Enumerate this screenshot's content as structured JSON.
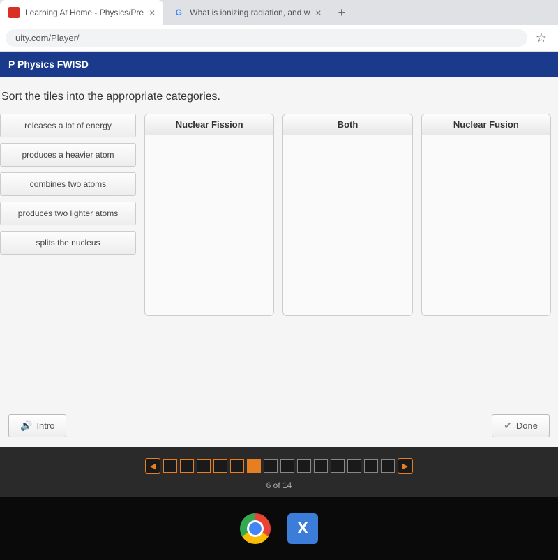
{
  "tabs": [
    {
      "title": "Learning At Home - Physics/Pre",
      "icon": "e"
    },
    {
      "title": "What is ionizing radiation, and w",
      "icon": "G"
    }
  ],
  "address": "uity.com/Player/",
  "course_title": "P Physics FWISD",
  "instruction": "Sort the tiles into the appropriate categories.",
  "tiles": [
    "releases a lot of energy",
    "produces a heavier atom",
    "combines two atoms",
    "produces two lighter atoms",
    "splits the nucleus"
  ],
  "categories": [
    "Nuclear Fission",
    "Both",
    "Nuclear Fusion"
  ],
  "buttons": {
    "intro": "Intro",
    "done": "Done"
  },
  "progress": {
    "current": 6,
    "total": 14,
    "label": "6 of 14"
  }
}
